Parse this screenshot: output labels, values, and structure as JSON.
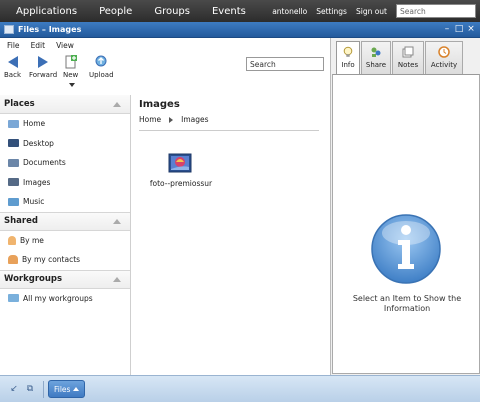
{
  "topnav": {
    "items": [
      "Applications",
      "People",
      "Groups",
      "Events"
    ],
    "user": "antonello",
    "settings": "Settings",
    "signout": "Sign out",
    "search_placeholder": "Search"
  },
  "window": {
    "title": "Files – Images"
  },
  "menu": {
    "items": [
      "File",
      "Edit",
      "View"
    ]
  },
  "toolbar": {
    "back": "Back",
    "forward": "Forward",
    "new": "New",
    "upload": "Upload"
  },
  "search": {
    "value": "Search"
  },
  "sidebar": {
    "places": {
      "title": "Places",
      "items": [
        "Home",
        "Desktop",
        "Documents",
        "Images",
        "Music"
      ]
    },
    "shared": {
      "title": "Shared",
      "items": [
        "By me",
        "By my contacts"
      ]
    },
    "workgroups": {
      "title": "Workgroups",
      "items": [
        "All my workgroups"
      ]
    }
  },
  "main": {
    "title": "Images",
    "breadcrumb": [
      "Home",
      "Images"
    ],
    "files": [
      {
        "name": "foto--premiossur"
      }
    ]
  },
  "info_panel": {
    "tabs": [
      "Info",
      "Share",
      "Notes",
      "Activity"
    ],
    "active_tab": "Info",
    "message_line1": "Select an Item to Show the",
    "message_line2": "Information"
  },
  "taskbar": {
    "app_button": "Files"
  },
  "colors": {
    "topbar": "#2c2c2c",
    "titlebar": "#235a9c",
    "accent": "#3c6fb6",
    "taskbar": "#b9d0e8",
    "info_icon": "#5b95d6"
  }
}
